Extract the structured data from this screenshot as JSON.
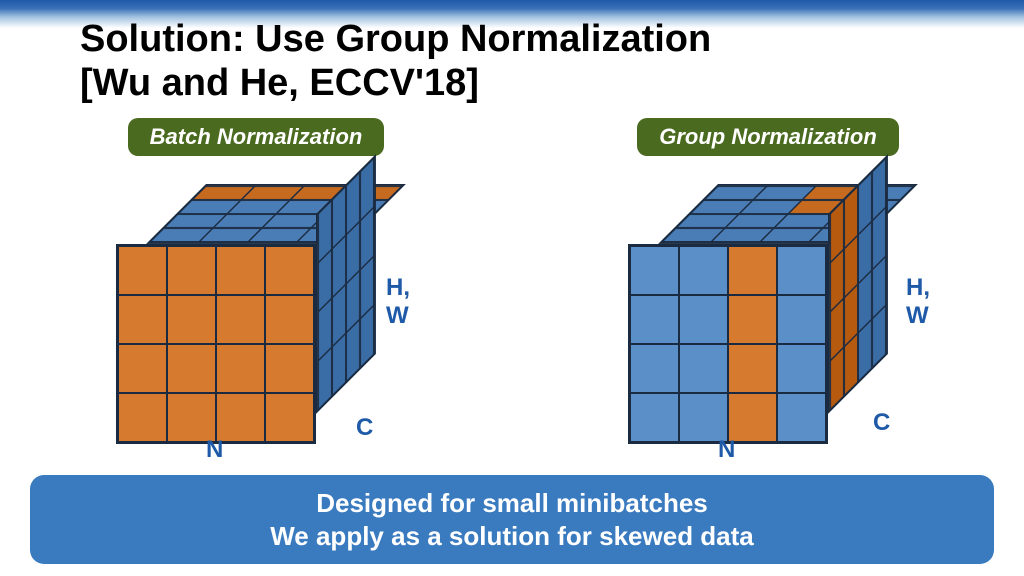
{
  "title_line1": "Solution: Use Group Normalization",
  "title_line2": "[Wu and He, ECCV'18]",
  "panels": {
    "left": {
      "badge": "Batch Normalization",
      "axis_hw": "H, W",
      "axis_c": "C",
      "axis_n": "N"
    },
    "right": {
      "badge": "Group Normalization",
      "axis_hw": "H, W",
      "axis_c": "C",
      "axis_n": "N"
    }
  },
  "footer_line1": "Designed for small minibatches",
  "footer_line2": "We apply as a solution for skewed data",
  "colors": {
    "cube_blue": "#5a8fc7",
    "cube_orange": "#d57a2f",
    "badge_bg": "#4a6b1f",
    "footer_bg": "#3a7bc0",
    "accent_text": "#1e5aa8"
  },
  "diagram": {
    "grid_n": 4,
    "grid_c": 4,
    "grid_hw": 4,
    "batch_norm_desc": "front face entirely orange (one channel slice across all N,H,W); top row of top-face orange; side face blue",
    "group_norm_desc": "front face column 3 orange (single N across all H,W); top face column 3 orange across depth; side columns 1-2 orange (group of channels for that N)"
  }
}
